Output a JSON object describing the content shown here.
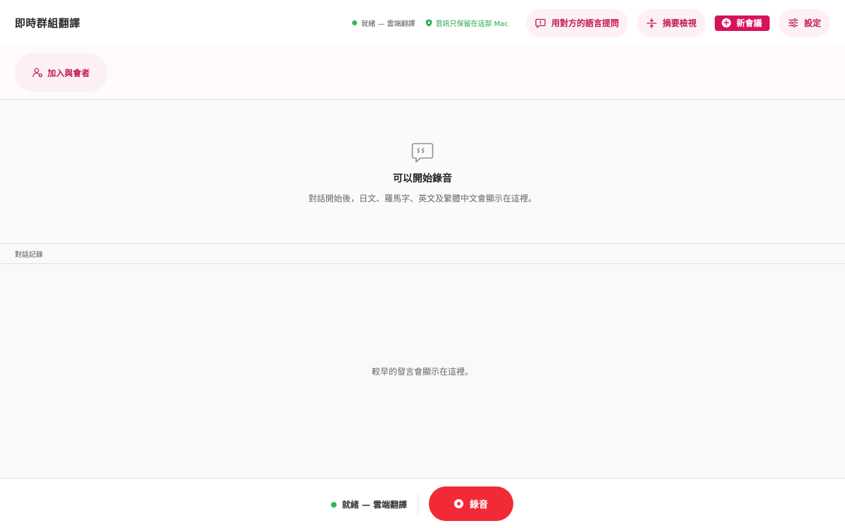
{
  "header": {
    "title": "即時群組翻譯",
    "status_text": "就緒 — 雲端翻譯",
    "privacy_text": "音訊只保留在這部 Mac",
    "ask_button_label": "用對方的語言提問",
    "summary_button_label": "摘要檢視",
    "new_meeting_label": "新會議",
    "settings_label": "設定"
  },
  "join": {
    "button_label": "加入與會者"
  },
  "empty_state": {
    "title": "可以開始錄音",
    "description": "對話開始後，日文、羅馬字、英文及繁體中文會顯示在這裡。"
  },
  "log": {
    "label": "對話記錄",
    "placeholder": "較早的發言會顯示在這裡。"
  },
  "footer": {
    "status_text": "就緒 — 雲端翻譯",
    "record_label": "錄音"
  },
  "colors": {
    "accent": "#d6145a",
    "record": "#f22a36",
    "status_green": "#2fb84f"
  },
  "icons": {
    "privacy": "shield-icon",
    "ask": "chat-question-icon",
    "summary": "compress-icon",
    "new_meeting": "plus-circle-icon",
    "settings": "sliders-icon",
    "join": "add-person-icon",
    "empty": "quote-bubble-icon",
    "record": "record-icon"
  }
}
